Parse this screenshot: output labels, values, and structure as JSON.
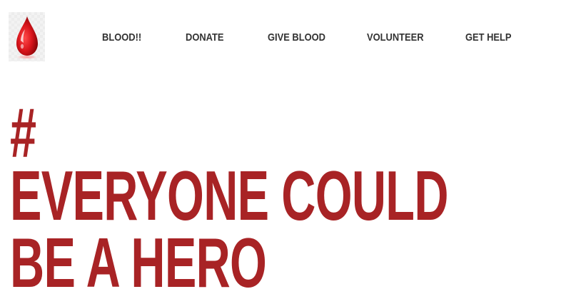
{
  "brand": {
    "logo_icon": "blood-drop-icon",
    "colors": {
      "accent": "#a82325",
      "nav_text": "#333333",
      "background": "#ffffff"
    }
  },
  "nav": {
    "items": [
      {
        "label": "BLOOD!!"
      },
      {
        "label": "DONATE"
      },
      {
        "label": "GIVE BLOOD"
      },
      {
        "label": "VOLUNTEER"
      },
      {
        "label": "GET HELP"
      }
    ]
  },
  "hero": {
    "hash": "#",
    "line1": "EVERYONE COULD",
    "line2": "BE A HERO"
  }
}
